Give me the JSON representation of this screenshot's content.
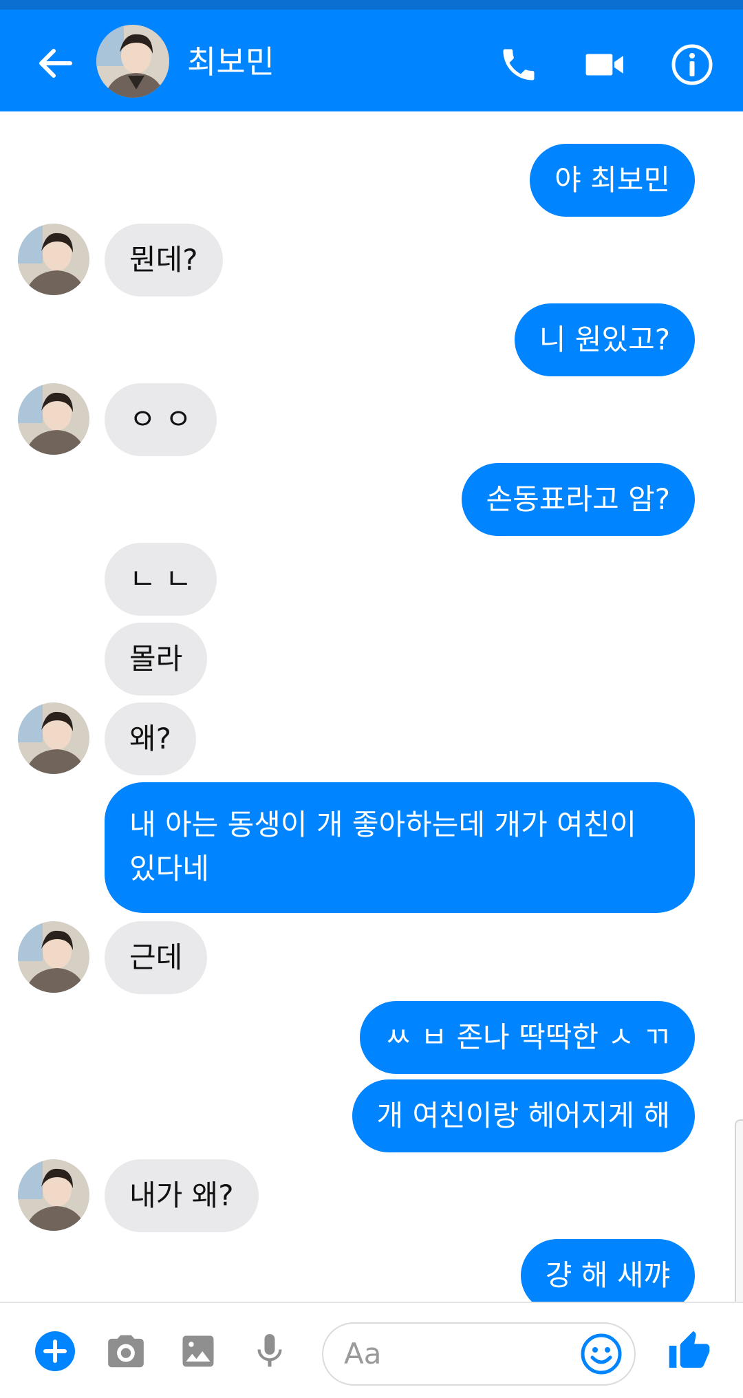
{
  "header": {
    "contact_name": "최보민",
    "background_color": "#0084ff",
    "back_icon": "arrow-left-icon",
    "call_icon": "phone-icon",
    "video_icon": "video-camera-icon",
    "info_icon": "info-icon"
  },
  "messages": [
    {
      "from": "me",
      "text": "야 최보민"
    },
    {
      "from": "them",
      "text": "뭔데?"
    },
    {
      "from": "me",
      "text": "니 원있고?"
    },
    {
      "from": "them",
      "text": "ㅇ ㅇ"
    },
    {
      "from": "me",
      "text": "손동표라고 암?"
    },
    {
      "from": "them",
      "text": "ㄴ ㄴ"
    },
    {
      "from": "them",
      "text": "몰라"
    },
    {
      "from": "them",
      "text": "왜?"
    },
    {
      "from": "me",
      "text": "내 아는 동생이 개 좋아하는데 개가 여친이 있다네"
    },
    {
      "from": "them",
      "text": "근데"
    },
    {
      "from": "me",
      "text": "ㅆ ㅂ 존나 딱딱한 ㅅ ㄲ"
    },
    {
      "from": "me",
      "text": "개 여친이랑 헤어지게 해"
    },
    {
      "from": "them",
      "text": "내가 왜?"
    },
    {
      "from": "me",
      "text": "걍 해 새꺄"
    }
  ],
  "composer": {
    "placeholder": "Aa",
    "add_icon": "plus-circle-icon",
    "camera_icon": "camera-icon",
    "gallery_icon": "image-icon",
    "mic_icon": "microphone-icon",
    "emoji_icon": "smiley-icon",
    "like_icon": "thumbs-up-icon"
  },
  "colors": {
    "outgoing_bubble": "#0084ff",
    "incoming_bubble": "#e9e9eb",
    "accent": "#0084ff"
  }
}
